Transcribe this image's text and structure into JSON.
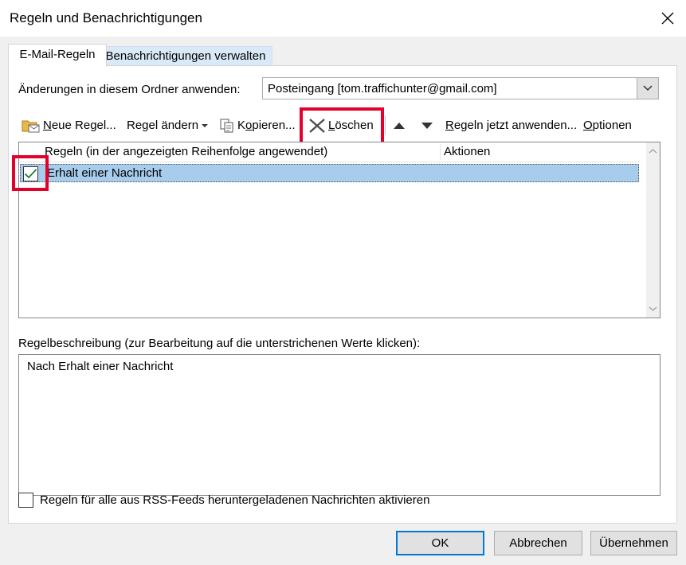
{
  "window": {
    "title": "Regeln und Benachrichtigungen"
  },
  "tabs": [
    {
      "label": "E-Mail-Regeln"
    },
    {
      "label": "Benachrichtigungen verwalten"
    }
  ],
  "folder": {
    "label": "Änderungen in diesem Ordner anwenden:",
    "value": "Posteingang [tom.traffichunter@gmail.com]"
  },
  "toolbar": {
    "new_rule_first": "N",
    "new_rule_rest": "eue Regel...",
    "change_rule": "Regel ändern",
    "copy_first": "o",
    "copy_pre": "K",
    "copy_rest": "pieren...",
    "delete_first": "L",
    "delete_rest": "öschen",
    "apply_first": "R",
    "apply_rest": "egeln jetzt anwenden...",
    "options_first": "O",
    "options_rest": "ptionen"
  },
  "rules_list": {
    "col_rules": "Regeln (in der angezeigten Reihenfolge angewendet)",
    "col_actions": "Aktionen",
    "rows": [
      {
        "name": "Erhalt einer Nachricht",
        "checked": true
      }
    ]
  },
  "description": {
    "label": "Regelbeschreibung (zur Bearbeitung auf die unterstrichenen Werte klicken):",
    "text": "Nach Erhalt einer Nachricht"
  },
  "rss": {
    "label": "Regeln für alle aus RSS-Feeds heruntergeladenen Nachrichten aktivieren"
  },
  "buttons": {
    "ok": "OK",
    "cancel": "Abbrechen",
    "apply": "Übernehmen"
  },
  "colors": {
    "highlight": "#e4002b",
    "selection": "#a8cdec",
    "accent": "#0078d7"
  }
}
